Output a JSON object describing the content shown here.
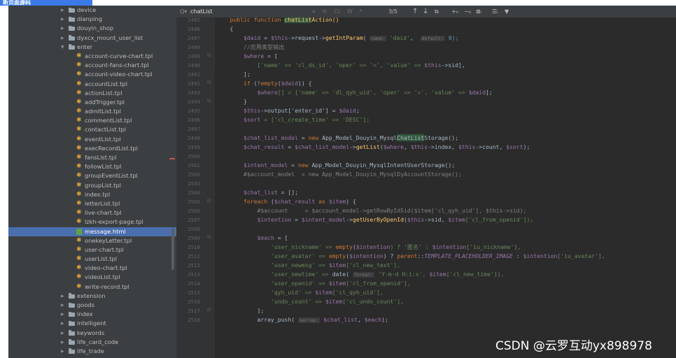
{
  "corner_badge": "新页面源码",
  "tree": {
    "rows": [
      {
        "label": "device",
        "type": "folder",
        "depth": 0,
        "expanded": false
      },
      {
        "label": "dianping",
        "type": "folder",
        "depth": 0,
        "expanded": false
      },
      {
        "label": "douyin_shop",
        "type": "folder",
        "depth": 0,
        "expanded": false
      },
      {
        "label": "dyxcx_mount_user_list",
        "type": "folder",
        "depth": 0,
        "expanded": false
      },
      {
        "label": "enter",
        "type": "folder",
        "depth": 0,
        "expanded": true
      },
      {
        "label": "account-curve-chart.tpl",
        "type": "tpl",
        "depth": 1
      },
      {
        "label": "account-fans-chart.tpl",
        "type": "tpl",
        "depth": 1
      },
      {
        "label": "account-video-chart.tpl",
        "type": "tpl",
        "depth": 1
      },
      {
        "label": "accountList.tpl",
        "type": "tpl",
        "depth": 1
      },
      {
        "label": "actionList.tpl",
        "type": "tpl",
        "depth": 1
      },
      {
        "label": "addTrigger.tpl",
        "type": "tpl",
        "depth": 1
      },
      {
        "label": "admitList.tpl",
        "type": "tpl",
        "depth": 1
      },
      {
        "label": "commentList.tpl",
        "type": "tpl",
        "depth": 1
      },
      {
        "label": "contactList.tpl",
        "type": "tpl",
        "depth": 1
      },
      {
        "label": "eventList.tpl",
        "type": "tpl",
        "depth": 1
      },
      {
        "label": "execRecordList.tpl",
        "type": "tpl",
        "depth": 1
      },
      {
        "label": "fansList.tpl",
        "type": "tpl",
        "depth": 1
      },
      {
        "label": "followList.tpl",
        "type": "tpl",
        "depth": 1
      },
      {
        "label": "groupEventList.tpl",
        "type": "tpl",
        "depth": 1
      },
      {
        "label": "groupList.tpl",
        "type": "tpl",
        "depth": 1
      },
      {
        "label": "index.tpl",
        "type": "tpl",
        "depth": 1
      },
      {
        "label": "letterList.tpl",
        "type": "tpl",
        "depth": 1
      },
      {
        "label": "live-chart.tpl",
        "type": "tpl",
        "depth": 1
      },
      {
        "label": "lzkh-export-page.tpl",
        "type": "tpl",
        "depth": 1
      },
      {
        "label": "message.html",
        "type": "html",
        "depth": 1,
        "selected": true
      },
      {
        "label": "onekeyLetter.tpl",
        "type": "tpl",
        "depth": 1
      },
      {
        "label": "user-chart.tpl",
        "type": "tpl",
        "depth": 1
      },
      {
        "label": "userList.tpl",
        "type": "tpl",
        "depth": 1
      },
      {
        "label": "video-chart.tpl",
        "type": "tpl",
        "depth": 1
      },
      {
        "label": "videoList.tpl",
        "type": "tpl",
        "depth": 1
      },
      {
        "label": "write-record.tpl",
        "type": "tpl",
        "depth": 1
      },
      {
        "label": "extension",
        "type": "folder",
        "depth": 0,
        "expanded": false
      },
      {
        "label": "goods",
        "type": "folder",
        "depth": 0,
        "expanded": false
      },
      {
        "label": "index",
        "type": "folder",
        "depth": 0,
        "expanded": false
      },
      {
        "label": "intelligent",
        "type": "folder",
        "depth": 0,
        "expanded": false
      },
      {
        "label": "keywords",
        "type": "folder",
        "depth": 0,
        "expanded": false
      },
      {
        "label": "life_card_code",
        "type": "folder",
        "depth": 0,
        "expanded": false
      },
      {
        "label": "life_trade",
        "type": "folder",
        "depth": 0,
        "expanded": false
      }
    ]
  },
  "findbar": {
    "search_icon": "Q▾",
    "query": "chatList",
    "clear_icon": "×",
    "history_icon": "⟲",
    "match_case": "Cc",
    "whole_words": "W",
    "regex": ".*",
    "match_count": "3/5",
    "prev_icon": "↑",
    "next_icon": "↓",
    "select_all_icon": "⧉",
    "tools": [
      "+ₜᵢ",
      "−ₜᵢ",
      "⊠ᵢ",
      "☰ᵢ",
      "▼"
    ]
  },
  "editor": {
    "line_numbers": [
      "2485",
      "2486",
      "2487",
      "2488",
      "2489",
      "2490",
      "2491",
      "2492",
      "2493",
      "2494",
      "2495",
      "2496",
      "2497",
      "2498",
      "2499",
      "2500",
      "2501",
      "2502",
      "2503",
      "2504",
      "2505",
      "2506",
      "2507",
      "2508",
      "2509",
      "2510",
      "2511",
      "2512",
      "2513",
      "2514",
      "2515",
      "2516",
      "2517",
      "2518"
    ],
    "lines": [
      [
        {
          "t": "    public function ",
          "c": "kw"
        },
        {
          "t": "chatList",
          "c": "fn hl"
        },
        {
          "t": "Action()",
          "c": "fn"
        }
      ],
      [
        {
          "t": "    {",
          "c": "plain"
        }
      ],
      [
        {
          "t": "        ",
          "c": "plain"
        },
        {
          "t": "$daid",
          "c": "var"
        },
        {
          "t": " = ",
          "c": "plain"
        },
        {
          "t": "$this",
          "c": "var"
        },
        {
          "t": "->request->",
          "c": "plain"
        },
        {
          "t": "getIntParam",
          "c": "fn"
        },
        {
          "t": "( ",
          "c": "plain"
        },
        {
          "t": "name:",
          "c": "hint"
        },
        {
          "t": " 'daid'",
          "c": "str"
        },
        {
          "t": ",  ",
          "c": "plain"
        },
        {
          "t": "default:",
          "c": "hint"
        },
        {
          "t": " 0);",
          "c": "num"
        }
      ],
      [
        {
          "t": "        //应用类型输出",
          "c": "cmt"
        }
      ],
      [
        {
          "t": "        ",
          "c": "plain"
        },
        {
          "t": "$where",
          "c": "var"
        },
        {
          "t": " = [",
          "c": "plain"
        }
      ],
      [
        {
          "t": "            ['name' => 'cl_ds_id', 'oper' => '=', 'value' => ",
          "c": "str"
        },
        {
          "t": "$this",
          "c": "var"
        },
        {
          "t": "->sid],",
          "c": "plain"
        }
      ],
      [
        {
          "t": "        ];",
          "c": "plain"
        }
      ],
      [
        {
          "t": "        ",
          "c": "plain"
        },
        {
          "t": "if",
          "c": "kw"
        },
        {
          "t": " (!",
          "c": "plain"
        },
        {
          "t": "empty",
          "c": "kw"
        },
        {
          "t": "(",
          "c": "plain"
        },
        {
          "t": "$daid",
          "c": "var"
        },
        {
          "t": ")) {",
          "c": "plain"
        }
      ],
      [
        {
          "t": "            ",
          "c": "plain"
        },
        {
          "t": "$where",
          "c": "var"
        },
        {
          "t": "[] = ['name' => 'dl_qyh_uid', 'oper' => '=', 'value' => ",
          "c": "str"
        },
        {
          "t": "$daid",
          "c": "var"
        },
        {
          "t": "];",
          "c": "plain"
        }
      ],
      [
        {
          "t": "        }",
          "c": "plain"
        }
      ],
      [
        {
          "t": "        ",
          "c": "plain"
        },
        {
          "t": "$this",
          "c": "var"
        },
        {
          "t": "->output['enter_id'] = ",
          "c": "plain"
        },
        {
          "t": "$daid",
          "c": "var"
        },
        {
          "t": ";",
          "c": "plain"
        }
      ],
      [
        {
          "t": "        ",
          "c": "plain"
        },
        {
          "t": "$sort",
          "c": "var"
        },
        {
          "t": " = ['cl_create_time' => 'DESC'];",
          "c": "str"
        }
      ],
      [
        {
          "t": "",
          "c": "plain"
        }
      ],
      [
        {
          "t": "        ",
          "c": "plain"
        },
        {
          "t": "$chat_list_model",
          "c": "var"
        },
        {
          "t": " = ",
          "c": "plain"
        },
        {
          "t": "new",
          "c": "kw"
        },
        {
          "t": " App_Model_Douyin_Mysql",
          "c": "plain"
        },
        {
          "t": "ChatList",
          "c": "plain hl"
        },
        {
          "t": "Storage();",
          "c": "plain"
        }
      ],
      [
        {
          "t": "        ",
          "c": "plain"
        },
        {
          "t": "$chat_result",
          "c": "var"
        },
        {
          "t": " = ",
          "c": "plain"
        },
        {
          "t": "$chat_list_model",
          "c": "var"
        },
        {
          "t": "->",
          "c": "plain"
        },
        {
          "t": "getList",
          "c": "fn"
        },
        {
          "t": "(",
          "c": "plain"
        },
        {
          "t": "$where",
          "c": "var"
        },
        {
          "t": ", ",
          "c": "plain"
        },
        {
          "t": "$this",
          "c": "var"
        },
        {
          "t": "->index, ",
          "c": "plain"
        },
        {
          "t": "$this",
          "c": "var"
        },
        {
          "t": "->count, ",
          "c": "plain"
        },
        {
          "t": "$sort",
          "c": "var"
        },
        {
          "t": ");",
          "c": "plain"
        }
      ],
      [
        {
          "t": "",
          "c": "plain"
        }
      ],
      [
        {
          "t": "        ",
          "c": "plain"
        },
        {
          "t": "$intent_model",
          "c": "var"
        },
        {
          "t": " = ",
          "c": "plain"
        },
        {
          "t": "new",
          "c": "kw"
        },
        {
          "t": " App_Model_Douyin_MysqlIntentUserStorage();",
          "c": "plain"
        }
      ],
      [
        {
          "t": "        #$account_model  = new App_Model_Douyin_MysqlDyAccountStorage();",
          "c": "cmt"
        }
      ],
      [
        {
          "t": "",
          "c": "plain"
        }
      ],
      [
        {
          "t": "        ",
          "c": "plain"
        },
        {
          "t": "$chat_list",
          "c": "var"
        },
        {
          "t": " = [];",
          "c": "plain"
        }
      ],
      [
        {
          "t": "        ",
          "c": "plain"
        },
        {
          "t": "foreach",
          "c": "kw"
        },
        {
          "t": " (",
          "c": "plain"
        },
        {
          "t": "$chat_result",
          "c": "var"
        },
        {
          "t": " as ",
          "c": "kw"
        },
        {
          "t": "$item",
          "c": "var"
        },
        {
          "t": ") {",
          "c": "plain"
        }
      ],
      [
        {
          "t": "            #$account     = $account_model->getRowByIdSid($item['cl_qyh_uid'], $this->sid);",
          "c": "cmt"
        }
      ],
      [
        {
          "t": "            ",
          "c": "plain"
        },
        {
          "t": "$intention",
          "c": "var"
        },
        {
          "t": " = ",
          "c": "plain"
        },
        {
          "t": "$intent_model",
          "c": "var"
        },
        {
          "t": "->",
          "c": "plain"
        },
        {
          "t": "getUserByOpenId",
          "c": "fn"
        },
        {
          "t": "(",
          "c": "plain"
        },
        {
          "t": "$this",
          "c": "var"
        },
        {
          "t": "->sid, ",
          "c": "plain"
        },
        {
          "t": "$item",
          "c": "var"
        },
        {
          "t": "['cl_from_openid']);",
          "c": "str"
        }
      ],
      [
        {
          "t": "",
          "c": "plain"
        }
      ],
      [
        {
          "t": "            ",
          "c": "plain"
        },
        {
          "t": "$each",
          "c": "var"
        },
        {
          "t": " = [",
          "c": "plain"
        }
      ],
      [
        {
          "t": "                'user_nickname' => ",
          "c": "str"
        },
        {
          "t": "empty",
          "c": "kw"
        },
        {
          "t": "(",
          "c": "plain"
        },
        {
          "t": "$intention",
          "c": "var"
        },
        {
          "t": ") ? '匿名' : ",
          "c": "str"
        },
        {
          "t": "$intention",
          "c": "var"
        },
        {
          "t": "['iu_nickname'],",
          "c": "str"
        }
      ],
      [
        {
          "t": "                'user_avatar' => ",
          "c": "str"
        },
        {
          "t": "empty",
          "c": "kw"
        },
        {
          "t": "(",
          "c": "plain"
        },
        {
          "t": "$intention",
          "c": "var"
        },
        {
          "t": ") ? ",
          "c": "plain"
        },
        {
          "t": "parent",
          "c": "kw"
        },
        {
          "t": "::",
          "c": "plain"
        },
        {
          "t": "TEMPLATE_PLACEHOLDER_IMAGE",
          "c": "ital"
        },
        {
          "t": " : ",
          "c": "plain"
        },
        {
          "t": "$intention",
          "c": "var"
        },
        {
          "t": "['iu_avatar'],",
          "c": "str"
        }
      ],
      [
        {
          "t": "                'user_newmsg' => ",
          "c": "str"
        },
        {
          "t": "$item",
          "c": "var"
        },
        {
          "t": "['cl_new_text'],",
          "c": "str"
        }
      ],
      [
        {
          "t": "                'user_newtime' => ",
          "c": "str"
        },
        {
          "t": "date",
          "c": "plain"
        },
        {
          "t": "( ",
          "c": "plain"
        },
        {
          "t": "format:",
          "c": "hint"
        },
        {
          "t": " 'Y-m-d H:i:s', ",
          "c": "str"
        },
        {
          "t": "$item",
          "c": "var"
        },
        {
          "t": "['cl_new_time']),",
          "c": "str"
        }
      ],
      [
        {
          "t": "                'user_openid' => ",
          "c": "str"
        },
        {
          "t": "$item",
          "c": "var"
        },
        {
          "t": "['cl_from_openid'],",
          "c": "str"
        }
      ],
      [
        {
          "t": "                'qyh_uid' => ",
          "c": "str"
        },
        {
          "t": "$item",
          "c": "var"
        },
        {
          "t": "['cl_qyh_uid'],",
          "c": "str"
        }
      ],
      [
        {
          "t": "                'undo_count' => ",
          "c": "str"
        },
        {
          "t": "$item",
          "c": "var"
        },
        {
          "t": "['cl_undo_count'],",
          "c": "str"
        }
      ],
      [
        {
          "t": "            ];",
          "c": "plain"
        }
      ],
      [
        {
          "t": "            ",
          "c": "plain"
        },
        {
          "t": "array_push",
          "c": "plain"
        },
        {
          "t": "( ",
          "c": "plain"
        },
        {
          "t": "&array:",
          "c": "hint"
        },
        {
          "t": " ",
          "c": "plain"
        },
        {
          "t": "$chat_list",
          "c": "var"
        },
        {
          "t": ", ",
          "c": "plain"
        },
        {
          "t": "$each",
          "c": "var"
        },
        {
          "t": ");",
          "c": "plain"
        }
      ]
    ]
  },
  "watermark": "CSDN @云罗互动yx898978",
  "colors": {
    "tree_bg": "#3c3f41",
    "editor_bg": "#2b2b2b",
    "gutter_bg": "#313335",
    "selection": "#4b6eaf",
    "keyword": "#cc7832",
    "variable": "#9876aa",
    "string": "#6a8759",
    "function": "#ffc66d"
  }
}
